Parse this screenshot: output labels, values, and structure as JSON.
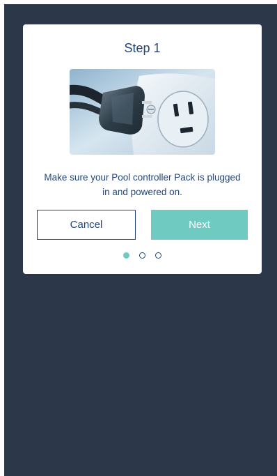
{
  "dialog": {
    "title": "Step 1",
    "illustration_icon": "power-plug-outlet-photo",
    "message": "Make sure your Pool controller Pack is plugged in and powered on.",
    "cancel_label": "Cancel",
    "next_label": "Next"
  },
  "pager": {
    "total_steps": 3,
    "current_step": 1
  },
  "colors": {
    "background": "#2c384a",
    "accent": "#6fcac1",
    "text": "#23467a"
  }
}
